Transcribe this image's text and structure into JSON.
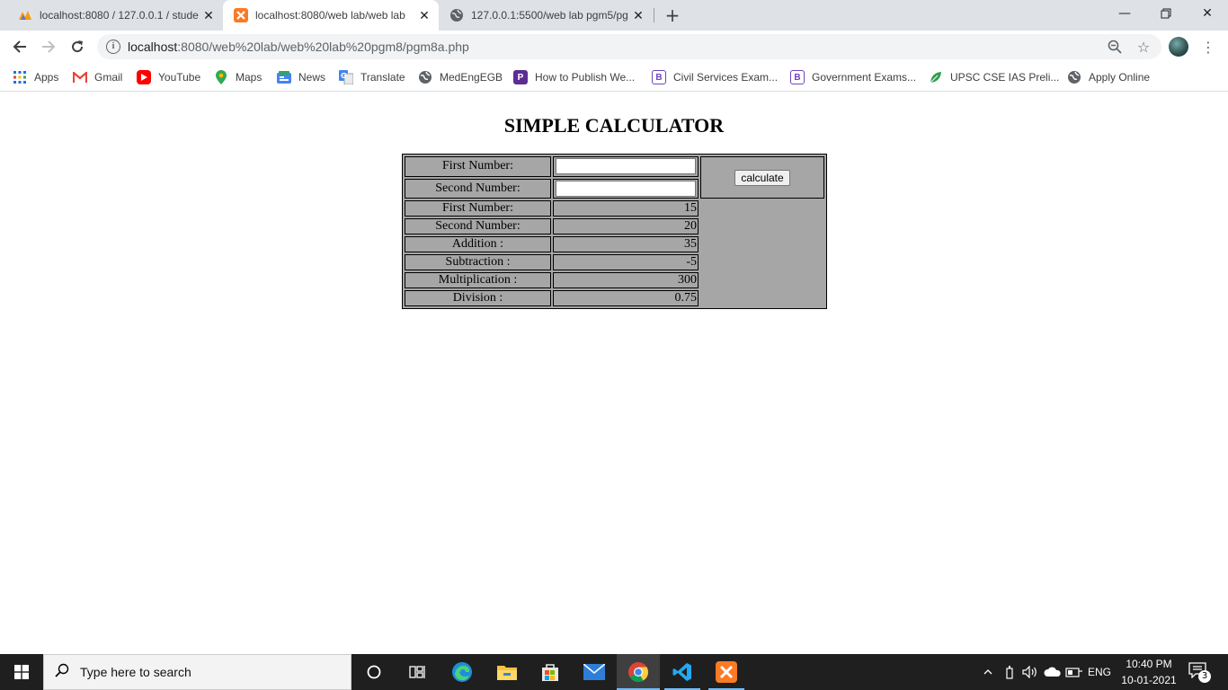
{
  "browser": {
    "tabs": [
      {
        "title": "localhost:8080 / 127.0.0.1 / stude",
        "icon": "phpmyadmin-icon",
        "active": false
      },
      {
        "title": "localhost:8080/web lab/web lab",
        "icon": "xampp-icon",
        "active": true
      },
      {
        "title": "127.0.0.1:5500/web lab pgm5/pg",
        "icon": "globe-icon",
        "active": false
      }
    ],
    "url_host": "localhost",
    "url_rest": ":8080/web%20lab/web%20lab%20pgm8/pgm8a.php",
    "bookmarks": [
      {
        "label": "Apps",
        "icon": "apps-grid-icon"
      },
      {
        "label": "Gmail",
        "icon": "gmail-icon"
      },
      {
        "label": "YouTube",
        "icon": "youtube-icon"
      },
      {
        "label": "Maps",
        "icon": "maps-pin-icon"
      },
      {
        "label": "News",
        "icon": "news-icon"
      },
      {
        "label": "Translate",
        "icon": "translate-icon"
      },
      {
        "label": "MedEngEGB",
        "icon": "globe-icon"
      },
      {
        "label": "How to Publish We...",
        "icon": "p-icon"
      },
      {
        "label": "Civil Services Exam...",
        "icon": "b-icon"
      },
      {
        "label": "Government Exams...",
        "icon": "b-icon"
      },
      {
        "label": "UPSC CSE IAS Preli...",
        "icon": "leaf-icon"
      },
      {
        "label": "Apply Online",
        "icon": "globe-icon"
      }
    ]
  },
  "page": {
    "title": "SIMPLE CALCULATOR",
    "first_label": "First Number:",
    "second_label": "Second Number:",
    "first_value": "",
    "second_value": "",
    "button_label": "calculate",
    "results": [
      {
        "label": "First Number:",
        "value": "15"
      },
      {
        "label": "Second Number:",
        "value": "20"
      },
      {
        "label": "Addition :",
        "value": "35"
      },
      {
        "label": "Subtraction :",
        "value": "-5"
      },
      {
        "label": "Multiplication :",
        "value": "300"
      },
      {
        "label": "Division :",
        "value": "0.75"
      }
    ]
  },
  "taskbar": {
    "search_placeholder": "Type here to search",
    "language": "ENG",
    "time": "10:40 PM",
    "date": "10-01-2021",
    "notification_count": "3"
  },
  "colors": {
    "tabstrip": "#dee1e6",
    "table_bg": "#a6a6a6",
    "taskbar": "#1f1f1f"
  }
}
